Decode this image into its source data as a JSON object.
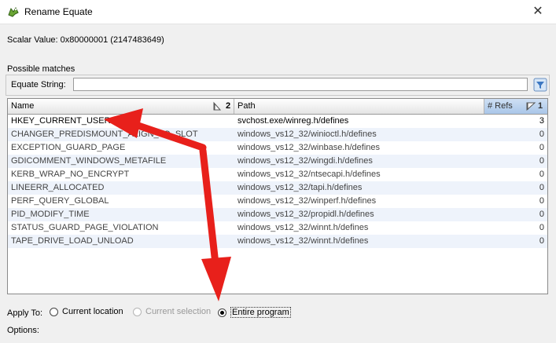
{
  "window": {
    "title": "Rename Equate",
    "close_glyph": "✕"
  },
  "scalar": {
    "text": "Scalar Value:  0x80000001 (2147483649)"
  },
  "possible_matches_label": "Possible matches",
  "filter": {
    "label": "Equate String:",
    "value": ""
  },
  "table": {
    "columns": {
      "name": "Name",
      "name_sort_order": "2",
      "path": "Path",
      "refs": "# Refs",
      "refs_sort_order": "1"
    },
    "rows": [
      {
        "name": "HKEY_CURRENT_USER",
        "path": "svchost.exe/winreg.h/defines",
        "refs": "3"
      },
      {
        "name": "CHANGER_PREDISMOUNT_ALIGN_TO_SLOT",
        "path": "windows_vs12_32/winioctl.h/defines",
        "refs": "0"
      },
      {
        "name": "EXCEPTION_GUARD_PAGE",
        "path": "windows_vs12_32/winbase.h/defines",
        "refs": "0"
      },
      {
        "name": "GDICOMMENT_WINDOWS_METAFILE",
        "path": "windows_vs12_32/wingdi.h/defines",
        "refs": "0"
      },
      {
        "name": "KERB_WRAP_NO_ENCRYPT",
        "path": "windows_vs12_32/ntsecapi.h/defines",
        "refs": "0"
      },
      {
        "name": "LINEERR_ALLOCATED",
        "path": "windows_vs12_32/tapi.h/defines",
        "refs": "0"
      },
      {
        "name": "PERF_QUERY_GLOBAL",
        "path": "windows_vs12_32/winperf.h/defines",
        "refs": "0"
      },
      {
        "name": "PID_MODIFY_TIME",
        "path": "windows_vs12_32/propidl.h/defines",
        "refs": "0"
      },
      {
        "name": "STATUS_GUARD_PAGE_VIOLATION",
        "path": "windows_vs12_32/winnt.h/defines",
        "refs": "0"
      },
      {
        "name": "TAPE_DRIVE_LOAD_UNLOAD",
        "path": "windows_vs12_32/winnt.h/defines",
        "refs": "0"
      }
    ]
  },
  "apply_to": {
    "label": "Apply To:",
    "options": [
      "Current location",
      "Current selection",
      "Entire program"
    ],
    "selected": "Entire program"
  },
  "options_label": "Options:",
  "colors": {
    "annotation_arrow": "#e8201b",
    "selected_column_header": "#bcd4ef",
    "alt_row": "#eef3fb"
  },
  "icons": {
    "app": "ghidra-dragon-icon",
    "filter": "filter-clear-icon",
    "sort": "sort-indicator-icon"
  }
}
